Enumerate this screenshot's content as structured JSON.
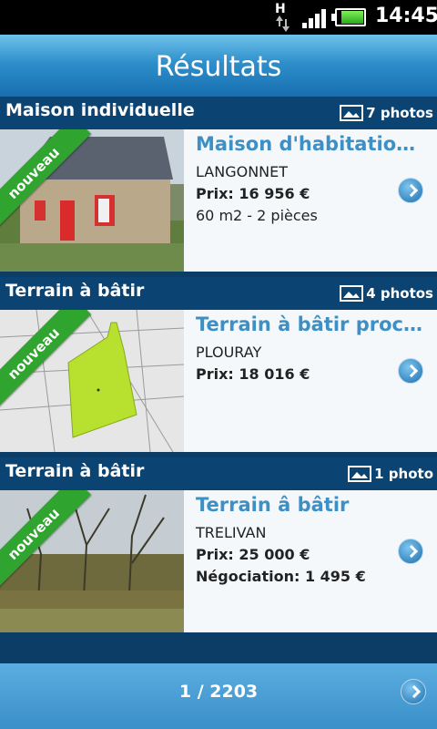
{
  "status_bar": {
    "network": "H",
    "time": "14:45"
  },
  "header": {
    "title": "Résultats"
  },
  "listings": [
    {
      "category": "Maison individuelle",
      "photos": "7 photos",
      "badge": "nouveau",
      "title": "Maison d'habitation en pierre",
      "city": "LANGONNET",
      "price": "Prix: 16 956 €",
      "extra": "60 m2 - 2 pièces"
    },
    {
      "category": "Terrain à bâtir",
      "photos": "4 photos",
      "badge": "nouveau",
      "title": "Terrain à bâtir proche bourg",
      "city": "PLOURAY",
      "price": "Prix: 18 016 €",
      "extra": ""
    },
    {
      "category": "Terrain à bâtir",
      "photos": "1 photo",
      "badge": "nouveau",
      "title": "Terrain â bâtir",
      "city": "TRELIVAN",
      "price": "Prix: 25 000 €",
      "extra": "Négociation: 1 495 €"
    }
  ],
  "footer": {
    "pager": "1 / 2203"
  },
  "colors": {
    "header": "#2e8fcb",
    "category_bar": "#0b4372",
    "title": "#3d8fc4",
    "badge": "#2fa52f"
  },
  "icons": [
    "photo-gallery-icon",
    "chevron-right-icon",
    "signal-icon",
    "battery-icon",
    "network-type-icon"
  ]
}
